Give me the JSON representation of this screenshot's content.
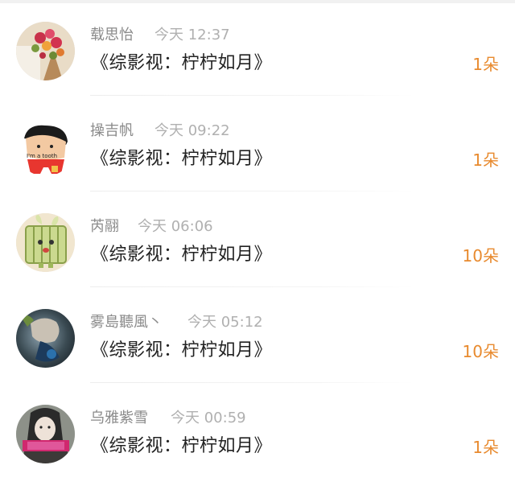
{
  "gifts": [
    {
      "name": "载思怡",
      "time": "今天 12:37",
      "title": "《综影视：柠柠如月》",
      "count": "1朵",
      "avatar_icon": "flowers-avatar-icon"
    },
    {
      "name": "操吉帆",
      "time": "今天 09:22",
      "title": "《综影视：柠柠如月》",
      "count": "1朵",
      "avatar_icon": "cartoon-tooth-avatar-icon",
      "avatar_caption": "I'm a tooth"
    },
    {
      "name": "芮翮",
      "time": "今天 06:06",
      "title": "《综影视：柠柠如月》",
      "count": "10朵",
      "avatar_icon": "cartoon-bunny-avatar-icon"
    },
    {
      "name": "雾島聽風丶",
      "time": "今天 05:12",
      "title": "《综影视：柠柠如月》",
      "count": "10朵",
      "avatar_icon": "photo-avatar-icon"
    },
    {
      "name": "乌雅紫雪",
      "time": "今天 00:59",
      "title": "《综影视：柠柠如月》",
      "count": "1朵",
      "avatar_icon": "portrait-avatar-icon"
    }
  ],
  "colors": {
    "accent": "#e88a2e",
    "name_text": "#8a8a8a",
    "time_text": "#b0b0b0",
    "title_text": "#222222"
  }
}
